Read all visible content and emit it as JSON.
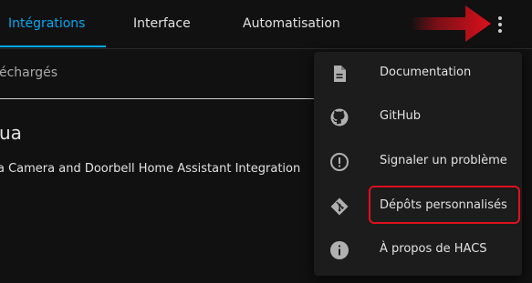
{
  "tabs": [
    {
      "label": "Intégrations"
    },
    {
      "label": "Interface"
    },
    {
      "label": "Automatisation"
    }
  ],
  "filter": {
    "text": "échargés"
  },
  "card": {
    "title": "ua",
    "description": "a Camera and Doorbell Home Assistant Integration"
  },
  "menu": {
    "items": [
      {
        "label": "Documentation",
        "icon": "document-icon"
      },
      {
        "label": "GitHub",
        "icon": "github-icon"
      },
      {
        "label": "Signaler un problème",
        "icon": "alert-circle-icon"
      },
      {
        "label": "Dépôts personnalisés",
        "icon": "git-icon"
      },
      {
        "label": "À propos de HACS",
        "icon": "info-icon"
      }
    ]
  },
  "colors": {
    "accent": "#03a9f4",
    "background": "#111111",
    "menu_background": "#1c1c1c",
    "annotation_red": "#e0101e"
  }
}
